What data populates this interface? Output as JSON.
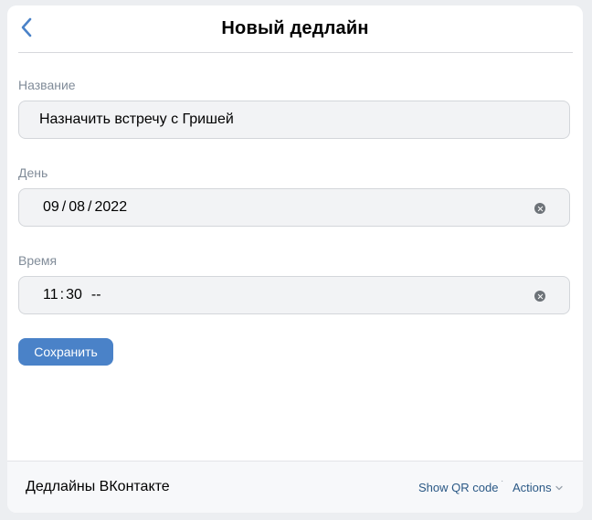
{
  "header": {
    "title": "Новый дедлайн",
    "back_icon": "chevron-left-icon"
  },
  "form": {
    "name": {
      "label": "Название",
      "value": "Назначить встречу с Гришей"
    },
    "day": {
      "label": "День",
      "month": "09",
      "day": "08",
      "year": "2022",
      "separator": "/"
    },
    "time": {
      "label": "Время",
      "hours": "11",
      "minutes": "30",
      "separator": ":",
      "ampm": "--"
    },
    "save_label": "Сохранить"
  },
  "footer": {
    "app_name": "Дедлайны ВКонтакте",
    "qr_label": "Show QR code",
    "dot": "·",
    "actions_label": "Actions"
  },
  "colors": {
    "accent": "#4a82c8",
    "link": "#2a5885",
    "label": "#818c99",
    "field_bg": "#f2f3f5"
  }
}
